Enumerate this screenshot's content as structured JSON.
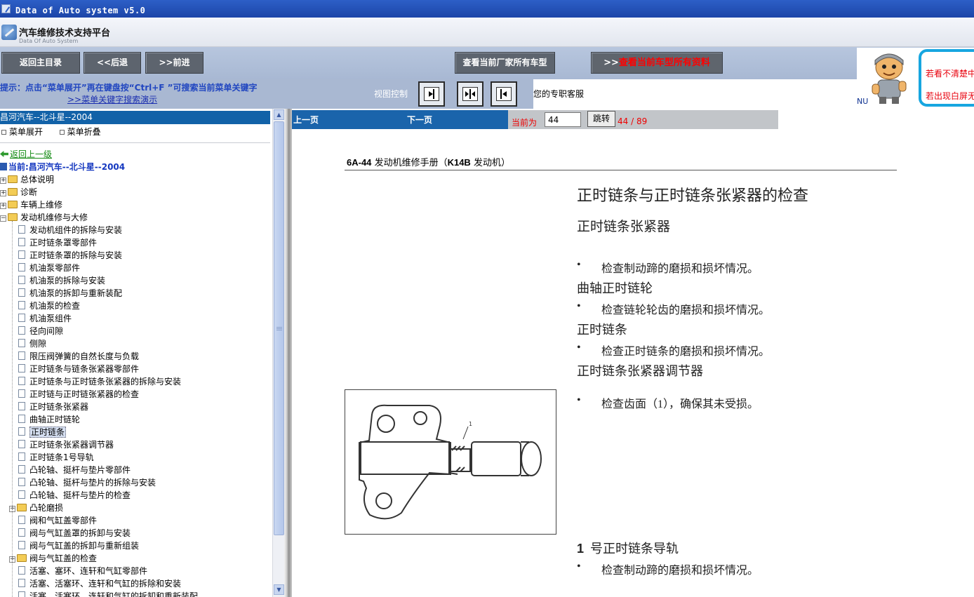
{
  "window": {
    "title": "Data of Auto system v5.0"
  },
  "brand": {
    "name": "汽车维修技术支持平台",
    "subtitle": "Data Of Auto System"
  },
  "nav": {
    "home": "返回主目录",
    "back": "<<后退",
    "forward": ">>前进",
    "all_models": "查看当前厂家所有车型",
    "all_docs_arrow": ">>",
    "all_docs": "查看当前车型所有资料"
  },
  "ad": {
    "line1": "若看不清楚中",
    "line2": "若出现白屏无",
    "nu": "NU"
  },
  "hint": {
    "text": "提示：点击“菜单展开”再在键盘按“Ctrl+F ”可搜索当前菜单关键字",
    "demo_link": ">>菜单关键字搜索演示",
    "view_control": "视图控制",
    "service": "您的专职客服"
  },
  "sidebar": {
    "header": "昌河汽车--北斗星--2004",
    "expand": "菜单展开",
    "collapse": "菜单折叠",
    "back": "返回上一级",
    "current": "当前:昌河汽车--北斗星--2004",
    "folders": [
      "总体说明",
      "诊断",
      "车辆上维修",
      "发动机维修与大修"
    ],
    "items": [
      "发动机组件的拆除与安装",
      "正时链条罩零部件",
      "正时链条罩的拆除与安装",
      "机油泵零部件",
      "机油泵的拆除与安装",
      "机油泵的拆卸与重新装配",
      "机油泵的检查",
      "机油泵组件",
      "径向间隙",
      "侧隙",
      "限压阀弹簧的自然长度与负载",
      "正时链条与链条张紧器零部件",
      "正时链条与正时链条张紧器的拆除与安装",
      "正时链与正时链张紧器的检查",
      "正时链条张紧器",
      "曲轴正时链轮",
      "正时链条",
      "正时链条张紧器调节器",
      "正时链条1号导轨",
      "凸轮轴、挺杆与垫片零部件",
      "凸轮轴、挺杆与垫片的拆除与安装",
      "凸轮轴、挺杆与垫片的检查",
      "凸轮磨损",
      "阀和气缸盖零部件",
      "阀与气缸盖罩的拆卸与安装",
      "阀与气缸盖的拆卸与重新组装",
      "阀与气缸盖的检查",
      "活塞、塞环、连轩和气缸零部件",
      "活塞、活塞环、连轩和气缸的拆除和安装",
      "活塞、活塞环、连轩和气缸的拆卸和重新装配"
    ],
    "selected": "正时链条"
  },
  "pager": {
    "prev": "上一页",
    "next": "下一页",
    "current_label": "当前为",
    "current_value": "44",
    "go": "跳转",
    "count": "44 / 89"
  },
  "document": {
    "header_code": "6A-44",
    "header_title": "发动机维修手册（",
    "header_engine": "K14B",
    "header_tail": " 发动机）",
    "title": "正时链条与正时链条张紧器的检查",
    "s1_title": "正时链条张紧器",
    "s1_bullet": "检查制动蹄的磨损和损坏情况。",
    "s2_title": "曲轴正时链轮",
    "s2_bullet": "检查链轮轮齿的磨损和损坏情况。",
    "s3_title": "正时链条",
    "s3_bullet": "检查正时链条的磨损和损坏情况。",
    "s4_title": "正时链条张紧器调节器",
    "s4_bullet": "检查齿面（1），确保其未受损。",
    "figure_callout": "1",
    "s5_num": "1",
    "s5_title": "号正时链条导轨",
    "s5_bullet": "检查制动蹄的磨损和损坏情况。"
  }
}
